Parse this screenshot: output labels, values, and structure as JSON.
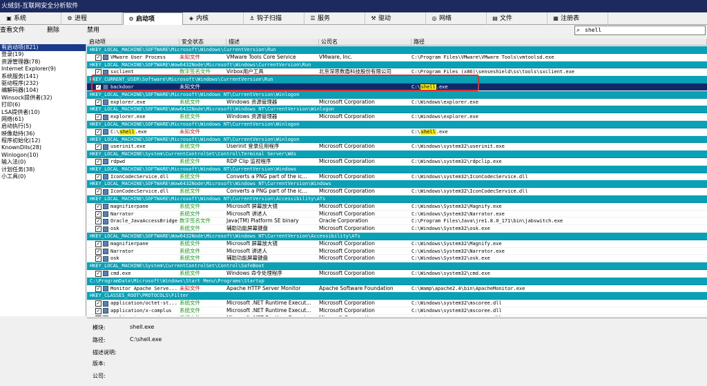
{
  "window": {
    "title": "火绒剑-互联网安全分析软件"
  },
  "tabs": [
    {
      "label": "系统",
      "icon": "system-icon"
    },
    {
      "label": "进程",
      "icon": "process-icon"
    },
    {
      "label": "启动项",
      "icon": "startup-icon",
      "active": true
    },
    {
      "label": "内核",
      "icon": "kernel-icon"
    },
    {
      "label": "钩子扫描",
      "icon": "hook-icon"
    },
    {
      "label": "服务",
      "icon": "service-icon"
    },
    {
      "label": "驱动",
      "icon": "driver-icon"
    },
    {
      "label": "网络",
      "icon": "network-icon"
    },
    {
      "label": "文件",
      "icon": "file-icon"
    },
    {
      "label": "注册表",
      "icon": "registry-icon"
    }
  ],
  "toolbar": {
    "view_file": "查看文件",
    "delete": "删除",
    "disable": "禁用"
  },
  "search": {
    "value": "shell"
  },
  "categories": [
    {
      "label": "有启动项(821)",
      "selected": true
    },
    {
      "label": "登录(19)"
    },
    {
      "label": "资源管理器(78)"
    },
    {
      "label": "Internet Explorer(9)"
    },
    {
      "label": "系统服务(141)"
    },
    {
      "label": "驱动程序(232)"
    },
    {
      "label": "编解码器(104)"
    },
    {
      "label": "Winsock提供者(32)"
    },
    {
      "label": "打印(6)"
    },
    {
      "label": "LSA提供者(10)"
    },
    {
      "label": "网络(61)"
    },
    {
      "label": "启动执行(5)"
    },
    {
      "label": "映像劫持(36)"
    },
    {
      "label": "程序初始化(12)"
    },
    {
      "label": "KnownDlls(28)"
    },
    {
      "label": "Winlogon(10)"
    },
    {
      "label": "输入法(0)"
    },
    {
      "label": "计划任务(38)"
    },
    {
      "label": "小工具(0)"
    }
  ],
  "columns": [
    "启动项",
    "安全状态",
    "描述",
    "公司名",
    "路径"
  ],
  "rows": [
    {
      "group": "HKEY_LOCAL_MACHINE\\SOFTWARE\\Microsoft\\Windows\\CurrentVersion\\Run"
    },
    {
      "name": "VMware User Process",
      "security": "未知文件",
      "status": "unk",
      "desc": "VMware Tools Core Service",
      "company": "VMware, Inc.",
      "path": "C:\\Program Files\\VMware\\VMware Tools\\vmtoolsd.exe"
    },
    {
      "group": "HKEY_LOCAL_MACHINE\\SOFTWARE\\Wow6432Node\\Microsoft\\Windows\\CurrentVersion\\Run"
    },
    {
      "name": "sxclient",
      "security": "数字签名文件",
      "status": "sig",
      "desc": "Virbox用户工具",
      "company": "北京深思数盾科技股份有限公司",
      "path": "C:\\Program Files (x86)\\senseshield\\ss\\tools\\sxclient.exe"
    },
    {
      "group": "HKEY_CURRENT_USER\\Software\\Microsoft\\Windows\\CurrentVersion\\Run"
    },
    {
      "name": "backdoor",
      "security": "未知文件",
      "status": "unk",
      "desc": "",
      "company": "",
      "path_pre": "C:\\",
      "path_hl": "shell",
      "path_post": ".exe",
      "selected": true
    },
    {
      "group": "HKEY_LOCAL_MACHINE\\SOFTWARE\\Microsoft\\Windows NT\\CurrentVersion\\Winlogon"
    },
    {
      "name": "explorer.exe",
      "security": "系统文件",
      "status": "sys",
      "desc": "Windows 资源管理器",
      "company": "Microsoft Corporation",
      "path": "C:\\Windows\\explorer.exe"
    },
    {
      "group": "HKEY_LOCAL_MACHINE\\SOFTWARE\\Wow6432Node\\Microsoft\\Windows NT\\CurrentVersion\\Winlogon"
    },
    {
      "name": "explorer.exe",
      "security": "系统文件",
      "status": "sys",
      "desc": "Windows 资源管理器",
      "company": "Microsoft Corporation",
      "path": "C:\\Windows\\explorer.exe"
    },
    {
      "group": "HKEY_LOCAL_MACHINE\\SOFTWARE\\Microsoft\\Windows NT\\CurrentVersion\\Winlogon"
    },
    {
      "name_pre": "C:\\",
      "name_hl": "shell",
      "name_post": ".exe",
      "security": "未知文件",
      "status": "unk",
      "desc": "",
      "company": "",
      "path_pre": "C:\\",
      "path_hl": "shell",
      "path_post": ".exe"
    },
    {
      "group": "HKEY_LOCAL_MACHINE\\SOFTWARE\\Microsoft\\Windows NT\\CurrentVersion\\Winlogon"
    },
    {
      "name": "userinit.exe",
      "security": "系统文件",
      "status": "sys",
      "desc": "Userinit 登录应用程序",
      "company": "Microsoft Corporation",
      "path": "C:\\Windows\\system32\\userinit.exe"
    },
    {
      "group": "HKEY_LOCAL_MACHINE\\System\\CurrentControlSet\\Control\\Terminal Server\\Wds"
    },
    {
      "name": "rdpwd",
      "security": "系统文件",
      "status": "sys",
      "desc": "RDP Clip 监视程序",
      "company": "Microsoft Corporation",
      "path": "C:\\Windows\\system32\\rdpclip.exe"
    },
    {
      "group": "HKEY_LOCAL_MACHINE\\SOFTWARE\\Microsoft\\Windows NT\\CurrentVersion\\Windows"
    },
    {
      "name": "IconCodecService.dll",
      "security": "系统文件",
      "status": "sys",
      "desc": "Converts a PNG part of the ic...",
      "company": "Microsoft Corporation",
      "path": "C:\\Windows\\system32\\IconCodecService.dll"
    },
    {
      "group": "HKEY_LOCAL_MACHINE\\SOFTWARE\\Wow6432Node\\Microsoft\\Windows NT\\CurrentVersion\\Windows"
    },
    {
      "name": "IconCodecService.dll",
      "security": "系统文件",
      "status": "sys",
      "desc": "Converts a PNG part of the ic...",
      "company": "Microsoft Corporation",
      "path": "C:\\Windows\\system32\\IconCodecService.dll"
    },
    {
      "group": "HKEY_LOCAL_MACHINE\\SOFTWARE\\Microsoft\\Windows NT\\CurrentVersion\\Accessibility\\ATs"
    },
    {
      "name": "magnifierpane",
      "security": "系统文件",
      "status": "sys",
      "desc": "Microsoft 屏幕放大镜",
      "company": "Microsoft Corporation",
      "path": "C:\\Windows\\System32\\Magnify.exe"
    },
    {
      "name": "Narrator",
      "security": "系统文件",
      "status": "sys",
      "desc": "Microsoft 讲述人",
      "company": "Microsoft Corporation",
      "path": "C:\\Windows\\System32\\Narrator.exe"
    },
    {
      "name": "Oracle_JavaAccessBridge",
      "security": "数字签名文件",
      "status": "sig",
      "desc": "Java(TM) Platform SE binary",
      "company": "Oracle Corporation",
      "path": "C:\\Program Files\\Java\\jre1.8.0_171\\bin\\jabswitch.exe"
    },
    {
      "name": "osk",
      "security": "系统文件",
      "status": "sys",
      "desc": "辅助功能屏幕键盘",
      "company": "Microsoft Corporation",
      "path": "C:\\Windows\\System32\\osk.exe"
    },
    {
      "group": "HKEY_LOCAL_MACHINE\\SOFTWARE\\Wow6432Node\\Microsoft\\Windows NT\\CurrentVersion\\Accessibility\\ATs"
    },
    {
      "name": "magnifierpane",
      "security": "系统文件",
      "status": "sys",
      "desc": "Microsoft 屏幕放大镜",
      "company": "Microsoft Corporation",
      "path": "C:\\Windows\\System32\\Magnify.exe"
    },
    {
      "name": "Narrator",
      "security": "系统文件",
      "status": "sys",
      "desc": "Microsoft 讲述人",
      "company": "Microsoft Corporation",
      "path": "C:\\Windows\\System32\\Narrator.exe"
    },
    {
      "name": "osk",
      "security": "系统文件",
      "status": "sys",
      "desc": "辅助功能屏幕键盘",
      "company": "Microsoft Corporation",
      "path": "C:\\Windows\\System32\\osk.exe"
    },
    {
      "group": "HKEY_LOCAL_MACHINE\\System\\CurrentControlSet\\Control\\SafeBoot"
    },
    {
      "name": "cmd.exe",
      "security": "系统文件",
      "status": "sys",
      "desc": "Windows 命令处理程序",
      "company": "Microsoft Corporation",
      "path": "C:\\Windows\\system32\\cmd.exe"
    },
    {
      "group": "C:\\ProgramData\\Microsoft\\Windows\\Start Menu\\Programs\\Startup"
    },
    {
      "name": "Monitor Apache Serve...",
      "security": "未知文件",
      "status": "unk",
      "desc": "Apache HTTP Server Monitor",
      "company": "Apache Software Foundation",
      "path": "C:\\Wamp\\apache2.4\\bin\\ApacheMonitor.exe"
    },
    {
      "group": "HKEY_CLASSES_ROOT\\PROTOCOLS\\Filter"
    },
    {
      "name": "application/octet-st...",
      "security": "系统文件",
      "status": "sys",
      "desc": "Microsoft .NET Runtime Execut...",
      "company": "Microsoft Corporation",
      "path": "C:\\Windows\\system32\\mscoree.dll"
    },
    {
      "name": "application/x-complus",
      "security": "系统文件",
      "status": "sys",
      "desc": "Microsoft .NET Runtime Execut...",
      "company": "Microsoft Corporation",
      "path": "C:\\Windows\\system32\\mscoree.dll"
    },
    {
      "name": "application/x-msdown...",
      "security": "系统文件",
      "status": "sys",
      "desc": "Microsoft .NET Runtime Execut...",
      "company": "Microsoft Corporation",
      "path": "C:\\Windows\\system32\\mscoree.dll"
    }
  ],
  "details": {
    "module_label": "模块:",
    "module_value": "shell.exe",
    "path_label": "路径:",
    "path_value": "C:\\shell.exe",
    "desc_label": "描述说明:",
    "version_label": "版本:",
    "company_label": "公司:"
  },
  "colors": {
    "title_bg": "#1d2a5f",
    "group_row": "#0aa0b5",
    "selected_row": "#0f2a6a",
    "highlight": "#f5e600",
    "unknown": "#d01010",
    "system": "#1a9a1a"
  }
}
